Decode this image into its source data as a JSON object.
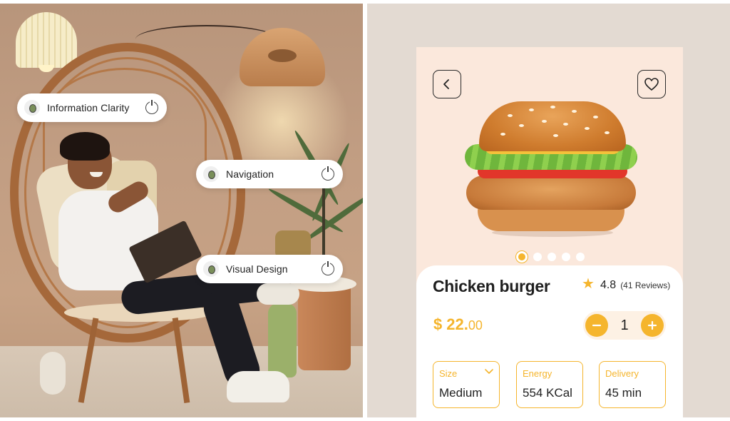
{
  "left_panel": {
    "pills": [
      {
        "label": "Information Clarity"
      },
      {
        "label": "Navigation"
      },
      {
        "label": "Visual Design"
      }
    ]
  },
  "product": {
    "name": "Chicken burger",
    "rating": "4.8",
    "reviews": "(41 Reviews)",
    "price_currency": "$",
    "price_whole": "22.",
    "price_cents": "00",
    "quantity": "1",
    "carousel": {
      "count": 5,
      "active": 1
    },
    "specs": [
      {
        "label": "Size",
        "value": "Medium"
      },
      {
        "label": "Energy",
        "value": "554 KCal"
      },
      {
        "label": "Delivery",
        "value": "45 min"
      }
    ]
  },
  "icons": {
    "back": "chevron-left-icon",
    "favorite": "heart-icon",
    "star": "star-icon",
    "minus": "minus-icon",
    "plus": "plus-icon",
    "power": "power-icon",
    "dropdown": "chevron-down-icon"
  },
  "colors": {
    "accent": "#f5b52d",
    "card_bg": "#fbe8dc",
    "panel_bg": "#e3dad2",
    "text": "#1f1f1f"
  }
}
